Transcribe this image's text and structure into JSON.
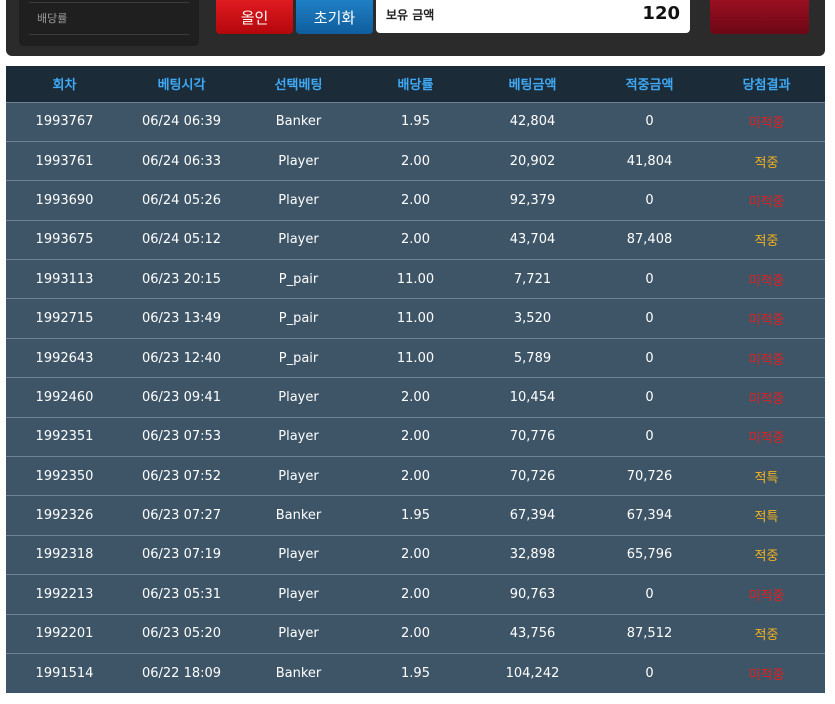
{
  "top": {
    "odds_label": "배당률",
    "allin_label": "올인",
    "reset_label": "초기화",
    "balance_label": "보유 금액",
    "balance_value": "120"
  },
  "table": {
    "headers": [
      "회차",
      "베팅시각",
      "선택베팅",
      "배당률",
      "베팅금액",
      "적중금액",
      "당첨결과"
    ],
    "rows": [
      {
        "round": "1993767",
        "time": "06/24 06:39",
        "pick": "Banker",
        "odds": "1.95",
        "bet": "42,804",
        "hit": "0",
        "result": "미적중",
        "status": "lose"
      },
      {
        "round": "1993761",
        "time": "06/24 06:33",
        "pick": "Player",
        "odds": "2.00",
        "bet": "20,902",
        "hit": "41,804",
        "result": "적중",
        "status": "win"
      },
      {
        "round": "1993690",
        "time": "06/24 05:26",
        "pick": "Player",
        "odds": "2.00",
        "bet": "92,379",
        "hit": "0",
        "result": "미적중",
        "status": "lose"
      },
      {
        "round": "1993675",
        "time": "06/24 05:12",
        "pick": "Player",
        "odds": "2.00",
        "bet": "43,704",
        "hit": "87,408",
        "result": "적중",
        "status": "win"
      },
      {
        "round": "1993113",
        "time": "06/23 20:15",
        "pick": "P_pair",
        "odds": "11.00",
        "bet": "7,721",
        "hit": "0",
        "result": "미적중",
        "status": "lose"
      },
      {
        "round": "1992715",
        "time": "06/23 13:49",
        "pick": "P_pair",
        "odds": "11.00",
        "bet": "3,520",
        "hit": "0",
        "result": "미적중",
        "status": "lose"
      },
      {
        "round": "1992643",
        "time": "06/23 12:40",
        "pick": "P_pair",
        "odds": "11.00",
        "bet": "5,789",
        "hit": "0",
        "result": "미적중",
        "status": "lose"
      },
      {
        "round": "1992460",
        "time": "06/23 09:41",
        "pick": "Player",
        "odds": "2.00",
        "bet": "10,454",
        "hit": "0",
        "result": "미적중",
        "status": "lose"
      },
      {
        "round": "1992351",
        "time": "06/23 07:53",
        "pick": "Player",
        "odds": "2.00",
        "bet": "70,776",
        "hit": "0",
        "result": "미적중",
        "status": "lose"
      },
      {
        "round": "1992350",
        "time": "06/23 07:52",
        "pick": "Player",
        "odds": "2.00",
        "bet": "70,726",
        "hit": "70,726",
        "result": "적특",
        "status": "win"
      },
      {
        "round": "1992326",
        "time": "06/23 07:27",
        "pick": "Banker",
        "odds": "1.95",
        "bet": "67,394",
        "hit": "67,394",
        "result": "적특",
        "status": "win"
      },
      {
        "round": "1992318",
        "time": "06/23 07:19",
        "pick": "Player",
        "odds": "2.00",
        "bet": "32,898",
        "hit": "65,796",
        "result": "적중",
        "status": "win"
      },
      {
        "round": "1992213",
        "time": "06/23 05:31",
        "pick": "Player",
        "odds": "2.00",
        "bet": "90,763",
        "hit": "0",
        "result": "미적중",
        "status": "lose"
      },
      {
        "round": "1992201",
        "time": "06/23 05:20",
        "pick": "Player",
        "odds": "2.00",
        "bet": "43,756",
        "hit": "87,512",
        "result": "적중",
        "status": "win"
      },
      {
        "round": "1991514",
        "time": "06/22 18:09",
        "pick": "Banker",
        "odds": "1.95",
        "bet": "104,242",
        "hit": "0",
        "result": "미적중",
        "status": "lose"
      }
    ]
  }
}
